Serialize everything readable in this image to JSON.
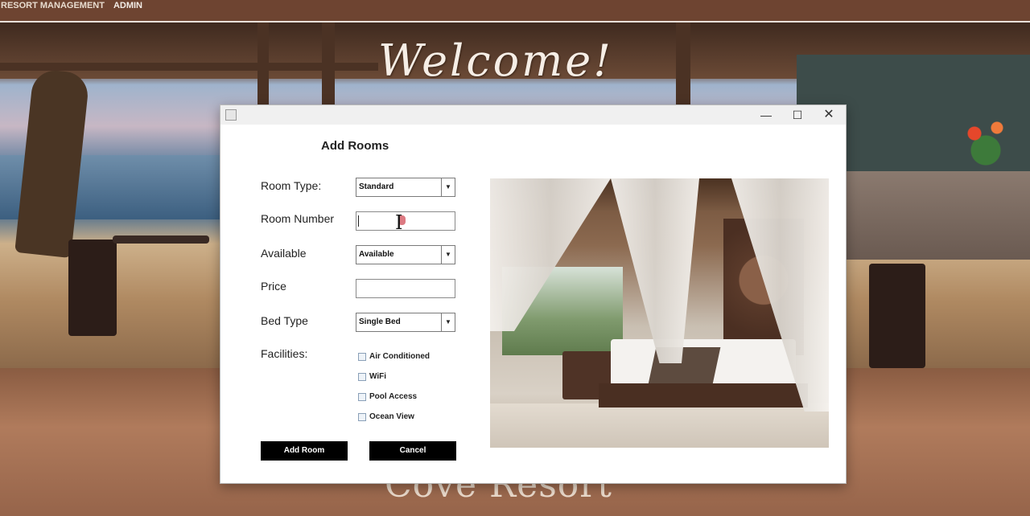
{
  "menubar": {
    "items": [
      {
        "label": "RESORT MANAGEMENT"
      },
      {
        "label": "ADMIN"
      }
    ]
  },
  "background": {
    "welcome_text": "Welcome!",
    "brand_text": "Cove Resort"
  },
  "dialog": {
    "window_controls": {
      "minimize": "—",
      "maximize": "☐",
      "close": "✕"
    },
    "title": "Add Rooms",
    "fields": {
      "room_type": {
        "label": "Room Type:",
        "value": "Standard"
      },
      "room_number": {
        "label": "Room Number",
        "value": ""
      },
      "available": {
        "label": "Available",
        "value": "Available"
      },
      "price": {
        "label": "Price",
        "value": ""
      },
      "bed_type": {
        "label": "Bed Type",
        "value": "Single Bed"
      }
    },
    "facilities": {
      "label": "Facilities:",
      "options": [
        {
          "label": "Air Conditioned",
          "checked": false
        },
        {
          "label": "WiFi",
          "checked": false
        },
        {
          "label": "Pool Access",
          "checked": false
        },
        {
          "label": "Ocean View",
          "checked": false
        }
      ]
    },
    "buttons": {
      "add": "Add Room",
      "cancel": "Cancel"
    }
  },
  "colors": {
    "menubar_bg": "#6e4431",
    "button_bg": "#000000",
    "dialog_bg": "#ffffff",
    "titlebar_bg": "#f0f0f0"
  }
}
